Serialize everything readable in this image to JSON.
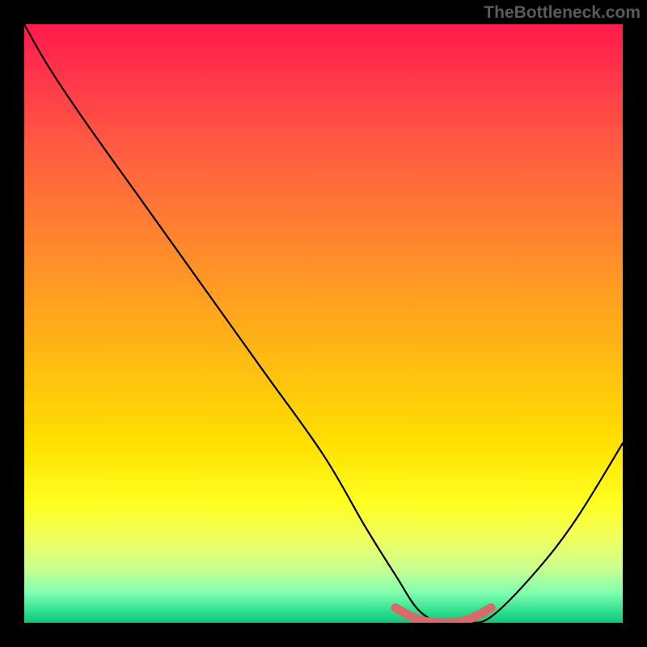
{
  "attribution": "TheBottleneck.com",
  "chart_data": {
    "type": "line",
    "title": "",
    "xlabel": "",
    "ylabel": "",
    "xlim": [
      0,
      100
    ],
    "ylim": [
      0,
      100
    ],
    "series": [
      {
        "name": "bottleneck-curve",
        "x": [
          0,
          4,
          10,
          20,
          30,
          40,
          50,
          57,
          62,
          66,
          70,
          74,
          78,
          85,
          92,
          100
        ],
        "y": [
          100,
          93,
          84,
          70,
          56,
          42,
          28,
          16,
          8,
          2,
          0,
          0,
          1,
          8,
          17,
          30
        ],
        "color": "#000000"
      },
      {
        "name": "highlight-segment",
        "x": [
          62,
          66,
          70,
          74,
          78
        ],
        "y": [
          2.5,
          0.5,
          0,
          0.5,
          2.5
        ],
        "color": "#d86a6a"
      }
    ],
    "gradient_stops": [
      {
        "pos": 0,
        "color": "#ff1a4a"
      },
      {
        "pos": 50,
        "color": "#ffc010"
      },
      {
        "pos": 80,
        "color": "#ffff20"
      },
      {
        "pos": 100,
        "color": "#10c878"
      }
    ]
  }
}
